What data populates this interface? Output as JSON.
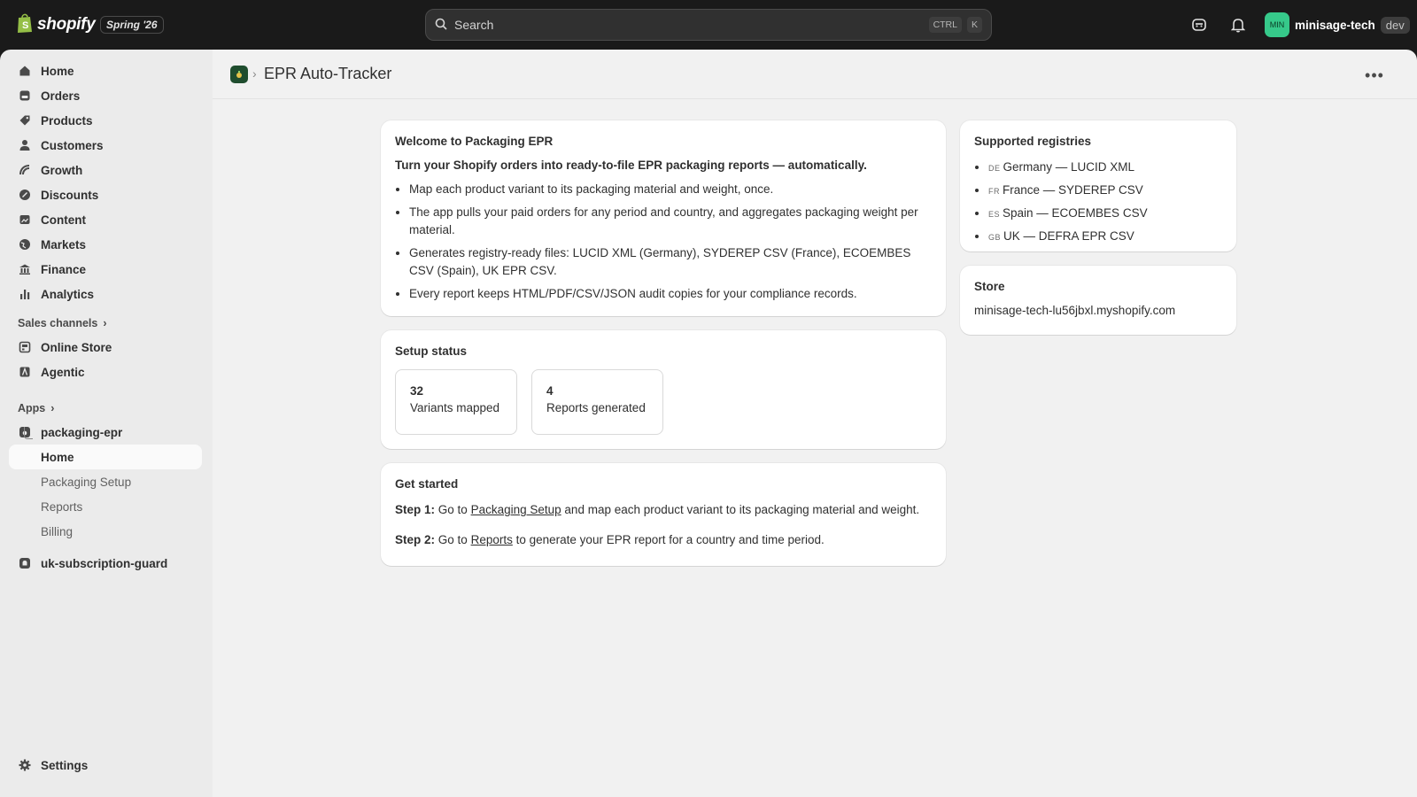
{
  "topbar": {
    "logo_text": "shopify",
    "edition": "Spring '26",
    "search_placeholder": "Search",
    "shortcut_ctrl": "CTRL",
    "shortcut_key": "K",
    "avatar_initials": "MIN",
    "account_name": "minisage-tech",
    "env_badge": "dev"
  },
  "sidebar": {
    "items": [
      {
        "label": "Home",
        "icon": "home-icon"
      },
      {
        "label": "Orders",
        "icon": "orders-icon"
      },
      {
        "label": "Products",
        "icon": "tag-icon"
      },
      {
        "label": "Customers",
        "icon": "person-icon"
      },
      {
        "label": "Growth",
        "icon": "growth-icon"
      },
      {
        "label": "Discounts",
        "icon": "discount-icon"
      },
      {
        "label": "Content",
        "icon": "content-icon"
      },
      {
        "label": "Markets",
        "icon": "globe-icon"
      },
      {
        "label": "Finance",
        "icon": "bank-icon"
      },
      {
        "label": "Analytics",
        "icon": "bar-chart-icon"
      }
    ],
    "sales_channels_label": "Sales channels",
    "channels": [
      {
        "label": "Online Store",
        "icon": "store-icon"
      },
      {
        "label": "Agentic",
        "icon": "agentic-icon"
      }
    ],
    "apps_label": "Apps",
    "app_name": "packaging-epr",
    "app_home": "Home",
    "app_subitems": [
      "Packaging Setup",
      "Reports",
      "Billing"
    ],
    "other_app": "uk-subscription-guard",
    "settings": "Settings"
  },
  "page": {
    "title": "EPR Auto-Tracker",
    "more_actions": "•••"
  },
  "welcome": {
    "title": "Welcome to Packaging EPR",
    "lead": "Turn your Shopify orders into ready-to-file EPR packaging reports — automatically.",
    "bullets": [
      "Map each product variant to its packaging material and weight, once.",
      "The app pulls your paid orders for any period and country, and aggregates packaging weight per material.",
      "Generates registry-ready files: LUCID XML (Germany), SYDEREP CSV (France), ECOEMBES CSV (Spain), UK EPR CSV.",
      "Every report keeps HTML/PDF/CSV/JSON audit copies for your compliance records."
    ]
  },
  "setup": {
    "title": "Setup status",
    "stats": [
      {
        "value": "32",
        "label": "Variants mapped"
      },
      {
        "value": "4",
        "label": "Reports generated"
      }
    ]
  },
  "get_started": {
    "title": "Get started",
    "step1_label": "Step 1:",
    "step1_pre": "Go to",
    "step1_link": "Packaging Setup",
    "step1_post": "and map each product variant to its packaging material and weight.",
    "step2_label": "Step 2:",
    "step2_pre": "Go to",
    "step2_link": "Reports",
    "step2_post": "to generate your EPR report for a country and time period."
  },
  "registries": {
    "title": "Supported registries",
    "items": [
      {
        "code": "DE",
        "text": "Germany — LUCID XML"
      },
      {
        "code": "FR",
        "text": "France — SYDEREP CSV"
      },
      {
        "code": "ES",
        "text": "Spain — ECOEMBES CSV"
      },
      {
        "code": "GB",
        "text": "UK — DEFRA EPR CSV"
      }
    ]
  },
  "store": {
    "title": "Store",
    "domain": "minisage-tech-lu56jbxl.myshopify.com"
  }
}
